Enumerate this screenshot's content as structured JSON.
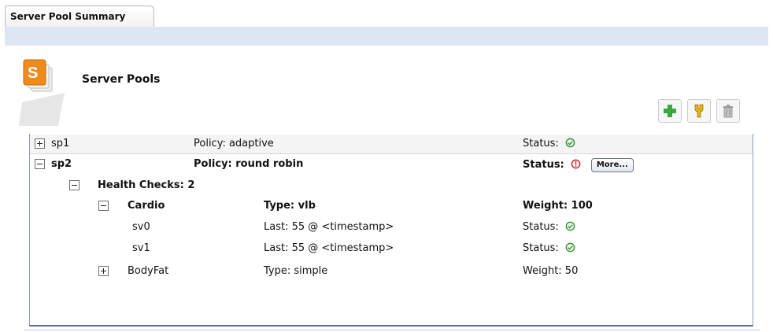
{
  "tab": {
    "label": "Server Pool Summary"
  },
  "header": {
    "title": "Server Pools"
  },
  "toolbar": [
    {
      "name": "add-button",
      "icon": "add-icon"
    },
    {
      "name": "edit-button",
      "icon": "wrench-icon"
    },
    {
      "name": "delete-button",
      "icon": "trash-icon"
    }
  ],
  "pools": [
    {
      "name": "sp1",
      "policy": "Policy: adaptive",
      "status": "Status:",
      "status_icon": "ok-icon",
      "expanded": false
    },
    {
      "name": "sp2",
      "policy": "Policy: round robin",
      "status": "Status:",
      "status_icon": "error-icon",
      "more": "More...",
      "expanded": true
    }
  ],
  "health_checks": {
    "label": "Health Checks: 2",
    "expanded": true
  },
  "checks": [
    {
      "name": "Cardio",
      "type": "Type: vlb",
      "weight": "Weight: 100",
      "expanded": true
    },
    {
      "name": "BodyFat",
      "type": "Type: simple",
      "weight": "Weight: 50",
      "expanded": false
    }
  ],
  "servers": [
    {
      "name": "sv0",
      "last": "Last: 55 @ <timestamp>",
      "status": "Status:",
      "status_icon": "ok-icon"
    },
    {
      "name": "sv1",
      "last": "Last: 55 @ <timestamp>",
      "status": "Status:",
      "status_icon": "ok-icon"
    }
  ],
  "colors": {
    "ok": "#2e9a2e",
    "error": "#d32020",
    "accent": "#dde7f3",
    "table_border": "#5a6a9c"
  }
}
